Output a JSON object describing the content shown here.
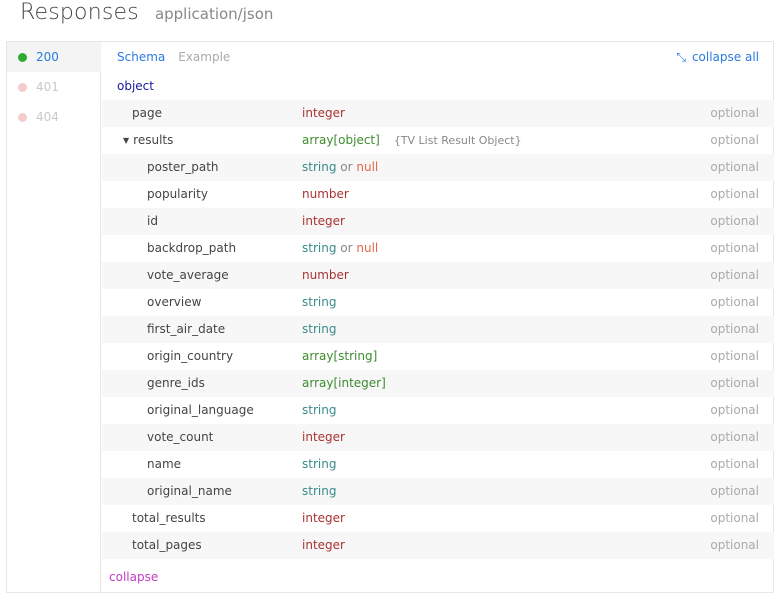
{
  "header": {
    "title": "Responses",
    "content_type": "application/json"
  },
  "status_codes": [
    {
      "code": "200",
      "active": true
    },
    {
      "code": "401",
      "active": false
    },
    {
      "code": "404",
      "active": false
    }
  ],
  "tabs": {
    "schema": "Schema",
    "example": "Example"
  },
  "collapse_all": "collapse all",
  "root_type": "object",
  "or_word": "or",
  "null_word": "null",
  "fields": [
    {
      "name": "page",
      "type": "integer",
      "level": 1,
      "required": "optional"
    },
    {
      "name": "results",
      "type": "array[object]",
      "ref": "{TV List Result Object}",
      "level": 1,
      "expandable": true,
      "required": "optional"
    },
    {
      "name": "poster_path",
      "type": "string",
      "nullable": true,
      "level": 2,
      "required": "optional"
    },
    {
      "name": "popularity",
      "type": "number",
      "level": 2,
      "required": "optional"
    },
    {
      "name": "id",
      "type": "integer",
      "level": 2,
      "required": "optional"
    },
    {
      "name": "backdrop_path",
      "type": "string",
      "nullable": true,
      "level": 2,
      "required": "optional"
    },
    {
      "name": "vote_average",
      "type": "number",
      "level": 2,
      "required": "optional"
    },
    {
      "name": "overview",
      "type": "string",
      "level": 2,
      "required": "optional"
    },
    {
      "name": "first_air_date",
      "type": "string",
      "level": 2,
      "required": "optional"
    },
    {
      "name": "origin_country",
      "type": "array[string]",
      "level": 2,
      "required": "optional"
    },
    {
      "name": "genre_ids",
      "type": "array[integer]",
      "level": 2,
      "required": "optional"
    },
    {
      "name": "original_language",
      "type": "string",
      "level": 2,
      "required": "optional"
    },
    {
      "name": "vote_count",
      "type": "integer",
      "level": 2,
      "required": "optional"
    },
    {
      "name": "name",
      "type": "string",
      "level": 2,
      "required": "optional"
    },
    {
      "name": "original_name",
      "type": "string",
      "level": 2,
      "required": "optional"
    },
    {
      "name": "total_results",
      "type": "integer",
      "level": 1,
      "required": "optional"
    },
    {
      "name": "total_pages",
      "type": "integer",
      "level": 1,
      "required": "optional"
    }
  ],
  "collapse": "collapse",
  "colors": {
    "accent": "#2a7ae2",
    "active_dot": "#2eaa2e",
    "inactive_dot": "#f4cccc",
    "string": "#3a8a8a",
    "number": "#a83232",
    "array": "#3d8b2f",
    "null": "#e06a4a",
    "collapse": "#c43bc4"
  }
}
